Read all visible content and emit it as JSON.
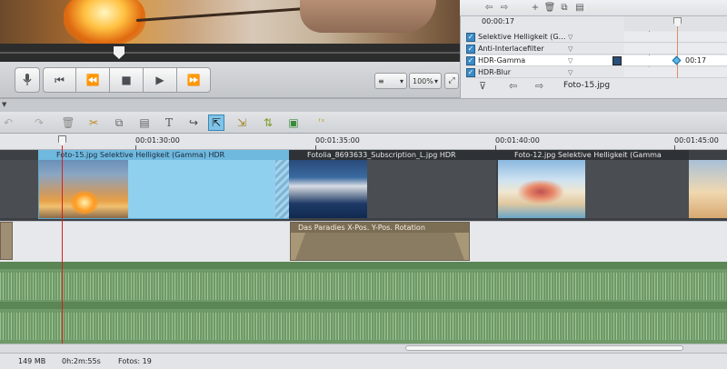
{
  "transport": {
    "zoom_value": "100%",
    "menu_icon": "≡",
    "mic_icon": "microphone-icon",
    "prev_icon": "⏮",
    "rew_icon": "⏪",
    "stop_icon": "■",
    "play_icon": "▶",
    "ff_icon": "⏩",
    "expand_icon": "⤢"
  },
  "effects_panel": {
    "time": "00:00:17",
    "rows": [
      {
        "label": "Selektive Helligkeit (G…",
        "checked": true
      },
      {
        "label": "Anti-Interlacefilter",
        "checked": true
      },
      {
        "label": "HDR-Gamma",
        "checked": true
      },
      {
        "label": "HDR-Blur",
        "checked": true
      }
    ],
    "keyframe_time": "00:17",
    "clip_name": "Foto-15.jpg"
  },
  "timeline": {
    "ruler": [
      "00:01:30:00",
      "00:01:35:00",
      "00:01:40:00",
      "00:01:45:00"
    ],
    "video_clips": [
      {
        "header": "Foto-15.jpg   Selektive Helligkeit (Gamma)   HDR"
      },
      {
        "header": "Fotolia_8693633_Subscription_L.jpg   HDR"
      },
      {
        "header": "Foto-12.jpg   Selektive Helligkeit (Gamma"
      }
    ],
    "title_clip": {
      "header": "Das Paradies   X-Pos.  Y-Pos.  Rotation"
    }
  },
  "status": {
    "memory": "149 MB",
    "duration": "0h:2m:55s",
    "photos": "Fotos: 19"
  }
}
